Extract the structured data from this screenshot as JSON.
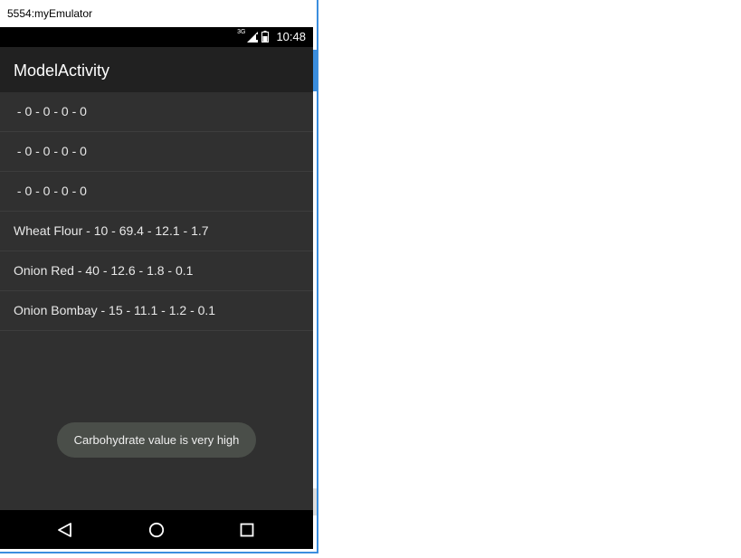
{
  "window": {
    "title": "5554:myEmulator"
  },
  "status_bar": {
    "network_label": "3G",
    "time": "10:48",
    "icons": [
      "signal-icon",
      "battery-icon"
    ]
  },
  "app_bar": {
    "title": "ModelActivity"
  },
  "list": {
    "items": [
      " - 0 - 0 - 0 - 0",
      " - 0 - 0 - 0 - 0",
      " - 0 - 0 - 0 - 0",
      "Wheat Flour - 10 - 69.4 - 12.1 - 1.7",
      "Onion Red - 40 - 12.6 - 1.8 - 0.1",
      "Onion Bombay - 15 - 11.1 - 1.2 - 0.1"
    ]
  },
  "toast": {
    "message": "Carbohydrate value is very high"
  },
  "nav_bar": {
    "buttons": [
      "back-icon",
      "home-icon",
      "recents-icon"
    ]
  },
  "colors": {
    "window_accent": "#3b8ede",
    "screen_background": "#303030",
    "app_bar": "#212121",
    "status_bar": "#000000",
    "nav_bar": "#000000",
    "toast_background": "#4a4e49"
  }
}
